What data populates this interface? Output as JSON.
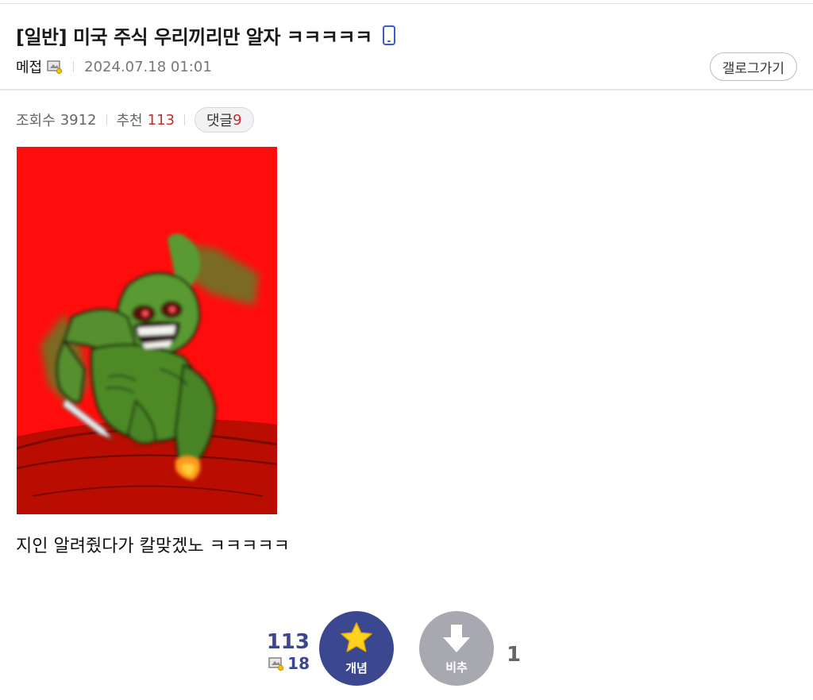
{
  "post": {
    "title": "[일반] 미국 주식 우리끼리만 알자 ㅋㅋㅋㅋㅋ",
    "author": "메접",
    "date": "2024.07.18 01:01",
    "gallery_button": "갤로그가기"
  },
  "stats": {
    "views_label": "조회수",
    "views": "3912",
    "recommend_label": "추천",
    "recommend": "113",
    "comments_label": "댓글",
    "comments": "9"
  },
  "content": {
    "image_icon": "green-monster-with-knife-image",
    "text": "지인 알려줬다가 칼맞겠노 ㅋㅋㅋㅋㅋ"
  },
  "vote": {
    "up_total": "113",
    "up_fixed": "18",
    "up_label": "개념",
    "down_label": "비추",
    "down_count": "1"
  },
  "colors": {
    "accent": "#3b4890",
    "highlight_red": "#c0302b",
    "downvote_gray": "#a8a8b0",
    "image_bg": "#ff0d0d"
  },
  "icons": {
    "mobile": "mobile-phone-icon",
    "author_badge": "gallery-badge-icon",
    "star": "star-icon",
    "down_arrow": "down-arrow-icon"
  }
}
